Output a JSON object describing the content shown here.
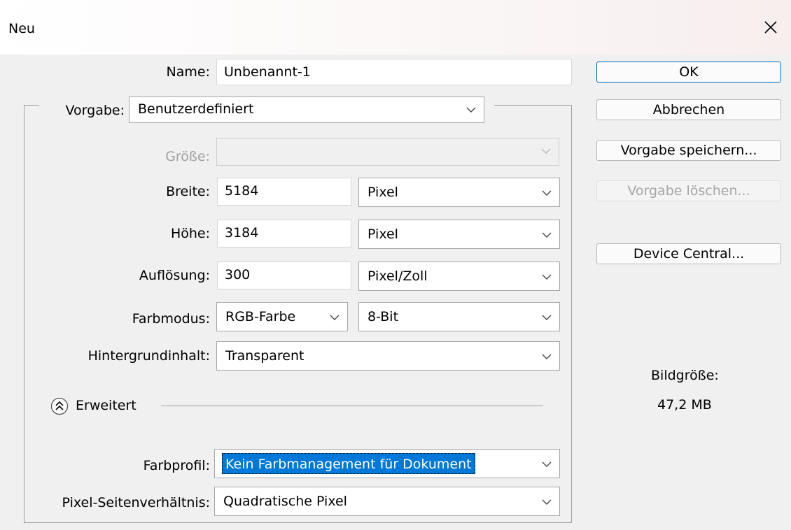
{
  "window": {
    "title": "Neu"
  },
  "form": {
    "name": {
      "label": "Name:",
      "value": "Unbenannt-1"
    },
    "preset": {
      "label": "Vorgabe:",
      "value": "Benutzerdefiniert"
    },
    "size": {
      "label": "Größe:",
      "value": ""
    },
    "width": {
      "label": "Breite:",
      "value": "5184",
      "unit": "Pixel"
    },
    "height": {
      "label": "Höhe:",
      "value": "3184",
      "unit": "Pixel"
    },
    "resolution": {
      "label": "Auflösung:",
      "value": "300",
      "unit": "Pixel/Zoll"
    },
    "color_mode": {
      "label": "Farbmodus:",
      "value": "RGB-Farbe",
      "depth": "8-Bit"
    },
    "background": {
      "label": "Hintergrundinhalt:",
      "value": "Transparent"
    },
    "advanced": {
      "label": "Erweitert"
    },
    "color_profile": {
      "label": "Farbprofil:",
      "value": "Kein Farbmanagement für Dokument"
    },
    "pixel_aspect": {
      "label": "Pixel-Seitenverhältnis:",
      "value": "Quadratische Pixel"
    }
  },
  "buttons": {
    "ok": "OK",
    "cancel": "Abbrechen",
    "save_preset": "Vorgabe speichern...",
    "delete_preset": "Vorgabe löschen...",
    "device_central": "Device Central..."
  },
  "image_size": {
    "label": "Bildgröße:",
    "value": "47,2 MB"
  },
  "colors": {
    "accent": "#0078d7",
    "default_button_border": "#0067c0",
    "disabled_text": "#a0a0a0"
  }
}
